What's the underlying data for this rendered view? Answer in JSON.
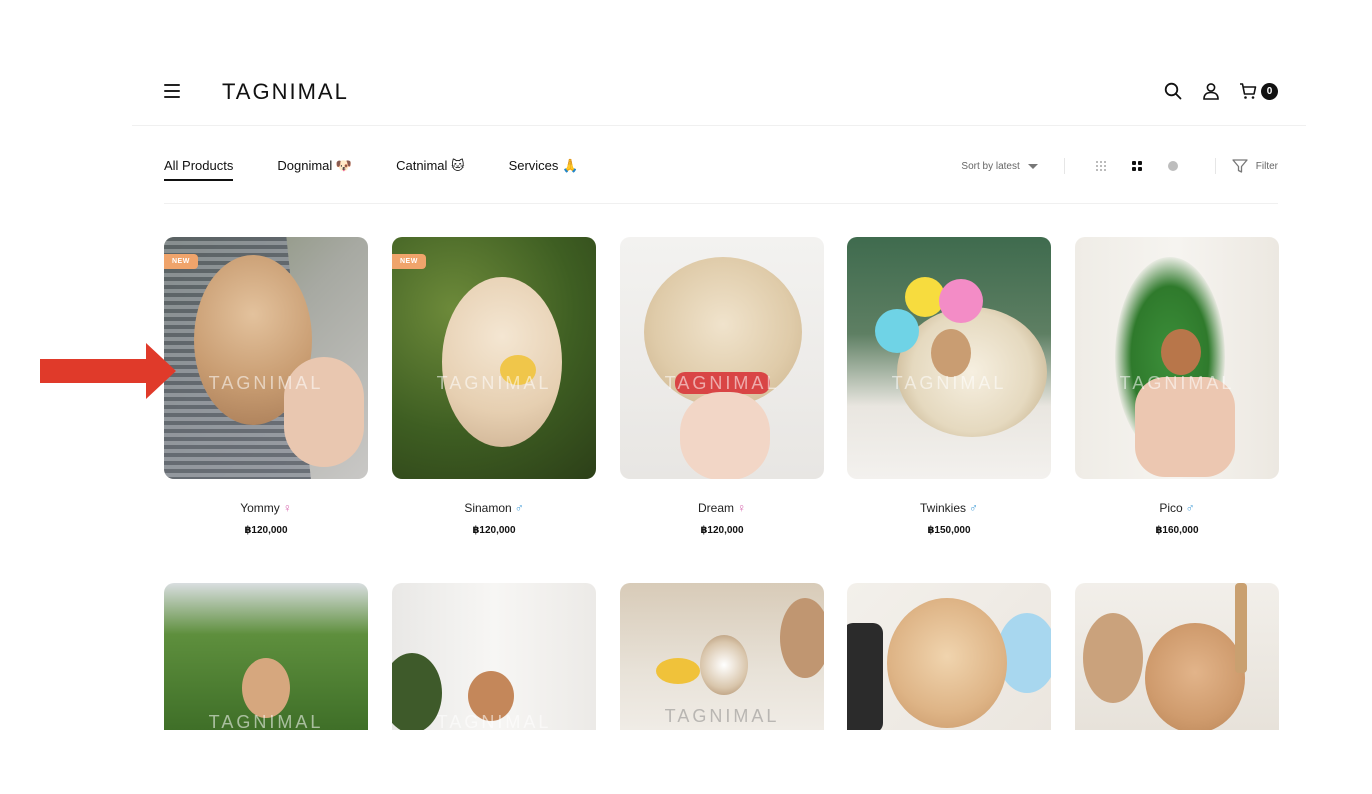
{
  "header": {
    "logo": "TAGNIMAL",
    "cart_count": "0",
    "icons": [
      "menu-icon",
      "search-icon",
      "user-icon",
      "cart-icon"
    ]
  },
  "categories": {
    "tabs": [
      {
        "label": "All Products",
        "active": true
      },
      {
        "label": "Dognimal 🐶",
        "active": false
      },
      {
        "label": "Catnimal 🐱",
        "active": false
      },
      {
        "label": "Services 🙏",
        "active": false
      }
    ],
    "sort_label": "Sort by latest",
    "filter_label": "Filter"
  },
  "products": [
    {
      "name": "Yommy",
      "sex": "♀",
      "price": "฿120,000",
      "badge": "NEW"
    },
    {
      "name": "Sinamon",
      "sex": "♂",
      "price": "฿120,000",
      "badge": "NEW"
    },
    {
      "name": "Dream",
      "sex": "♀",
      "price": "฿120,000",
      "badge": ""
    },
    {
      "name": "Twinkies",
      "sex": "♂",
      "price": "฿150,000",
      "badge": ""
    },
    {
      "name": "Pico",
      "sex": "♂",
      "price": "฿160,000",
      "badge": ""
    }
  ],
  "watermark": "TAGNIMAL",
  "colors": {
    "accent_arrow": "#e03a2a",
    "badge_new": "#f0a46b",
    "female": "#d86ab0",
    "male": "#4aa0d8"
  }
}
